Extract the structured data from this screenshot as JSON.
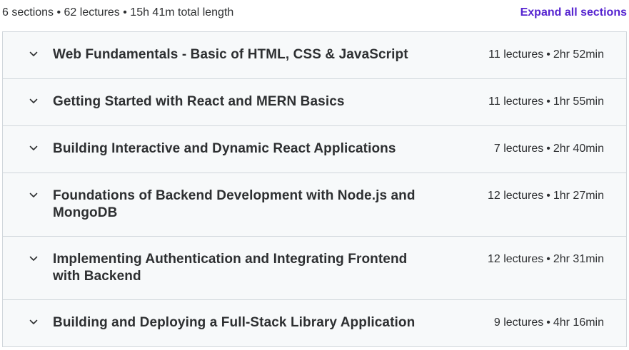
{
  "summary": {
    "text": "6 sections • 62 lectures • 15h 41m total length",
    "expand_label": "Expand all sections"
  },
  "colors": {
    "accent": "#5624d0",
    "section_bg": "#f7f9fa",
    "border": "#d1d7dc",
    "text": "#2d2f31"
  },
  "sections": [
    {
      "title": "Web Fundamentals - Basic of HTML, CSS & JavaScript",
      "lectures": "11 lectures",
      "duration": "2hr 52min",
      "icon": "chevron-down-icon"
    },
    {
      "title": "Getting Started with React and MERN Basics",
      "lectures": "11 lectures",
      "duration": "1hr 55min",
      "icon": "chevron-down-icon"
    },
    {
      "title": "Building Interactive and Dynamic React Applications",
      "lectures": "7 lectures",
      "duration": "2hr 40min",
      "icon": "chevron-down-icon"
    },
    {
      "title": "Foundations of Backend Development with Node.js and MongoDB",
      "lectures": "12 lectures",
      "duration": "1hr 27min",
      "icon": "chevron-down-icon"
    },
    {
      "title": "Implementing Authentication and Integrating Frontend with Backend",
      "lectures": "12 lectures",
      "duration": "2hr 31min",
      "icon": "chevron-down-icon"
    },
    {
      "title": "Building and Deploying a Full-Stack Library Application",
      "lectures": "9 lectures",
      "duration": "4hr 16min",
      "icon": "chevron-down-icon"
    }
  ],
  "separator": "•"
}
